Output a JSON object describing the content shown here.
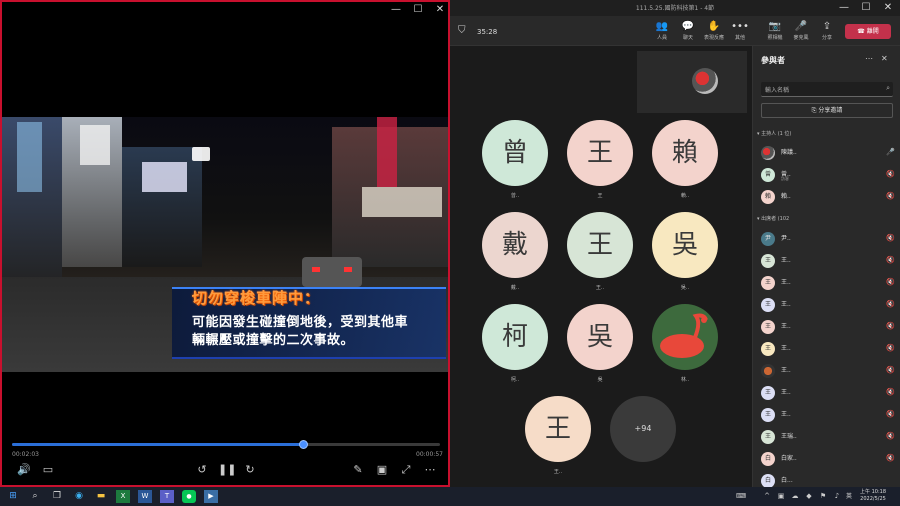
{
  "player": {
    "caption_title": "切勿穿梭車陣中：",
    "caption_line1": "可能因發生碰撞倒地後，受到其他車",
    "caption_line2": "輛輾壓或撞擊的二次事故。",
    "elapsed": "00:02:03",
    "remaining": "00:00:57",
    "progress_percent": 68,
    "controls": {
      "volume_icon": "volume-icon",
      "subtitles_icon": "subtitles-icon",
      "rewind_icon": "rewind-10-icon",
      "pause_icon": "pause-icon",
      "forward_icon": "forward-30-icon",
      "pen_icon": "pen-icon",
      "miniplayer_icon": "miniplayer-icon",
      "fullscreen_icon": "fullscreen-icon",
      "more_icon": "more-icon"
    }
  },
  "teams": {
    "window_title": "111.5.25.國防科技第1 - 4節",
    "timer": "35:28",
    "toolbar": {
      "people": "人員",
      "chat": "聊天",
      "reactions": "表現反應",
      "more": "其他",
      "camera": "照相機",
      "mic": "麥克風",
      "share": "分享",
      "leave": "離開"
    },
    "tiles": [
      {
        "char": "曾",
        "name": "曾..",
        "color": "#cfe8d8"
      },
      {
        "char": "王",
        "name": "王",
        "color": "#f3d3cc"
      },
      {
        "char": "賴",
        "name": "賴..",
        "color": "#f3d3cc"
      },
      {
        "char": "戴",
        "name": "戴..",
        "color": "#ecd6cf"
      },
      {
        "char": "王",
        "name": "王..",
        "color": "#d7e5d6"
      },
      {
        "char": "吳",
        "name": "吳..",
        "color": "#f8e8c0"
      },
      {
        "char": "柯",
        "name": "柯..",
        "color": "#cfe8d8"
      },
      {
        "char": "吳",
        "name": "吳",
        "color": "#f3d3cc"
      },
      {
        "char": "",
        "name": "林..",
        "color": "#3d6a3d"
      },
      {
        "char": "王",
        "name": "王..",
        "color": "#f6dcc8"
      }
    ],
    "overflow": "+94",
    "panel": {
      "title": "參與者",
      "search_placeholder": "輸入名稱",
      "share_invite": "分享邀請",
      "organizers_header": "主持人 (1 位)",
      "attendees_header": "出席者 (102",
      "organizers": [
        {
          "initial": "",
          "name": "陳議..",
          "sub": ""
        },
        {
          "initial": "曾",
          "name": "曾..",
          "sub": "訪客"
        },
        {
          "initial": "賴",
          "name": "賴..",
          "sub": ""
        }
      ],
      "attendees": [
        {
          "initial": "尹",
          "name": "尹.."
        },
        {
          "initial": "王",
          "name": "王.."
        },
        {
          "initial": "王",
          "name": "王.."
        },
        {
          "initial": "王",
          "name": "王.."
        },
        {
          "initial": "王",
          "name": "王.."
        },
        {
          "initial": "王",
          "name": "王.."
        },
        {
          "initial": "",
          "name": "王.."
        },
        {
          "initial": "王",
          "name": "王.."
        },
        {
          "initial": "王",
          "name": "王.."
        },
        {
          "initial": "王",
          "name": "王瑞.."
        },
        {
          "initial": "白",
          "name": "白家.."
        },
        {
          "initial": "白",
          "name": "白..."
        }
      ]
    }
  },
  "taskbar": {
    "time": "上午 10:18",
    "date": "2022/5/25",
    "lang": "英"
  }
}
